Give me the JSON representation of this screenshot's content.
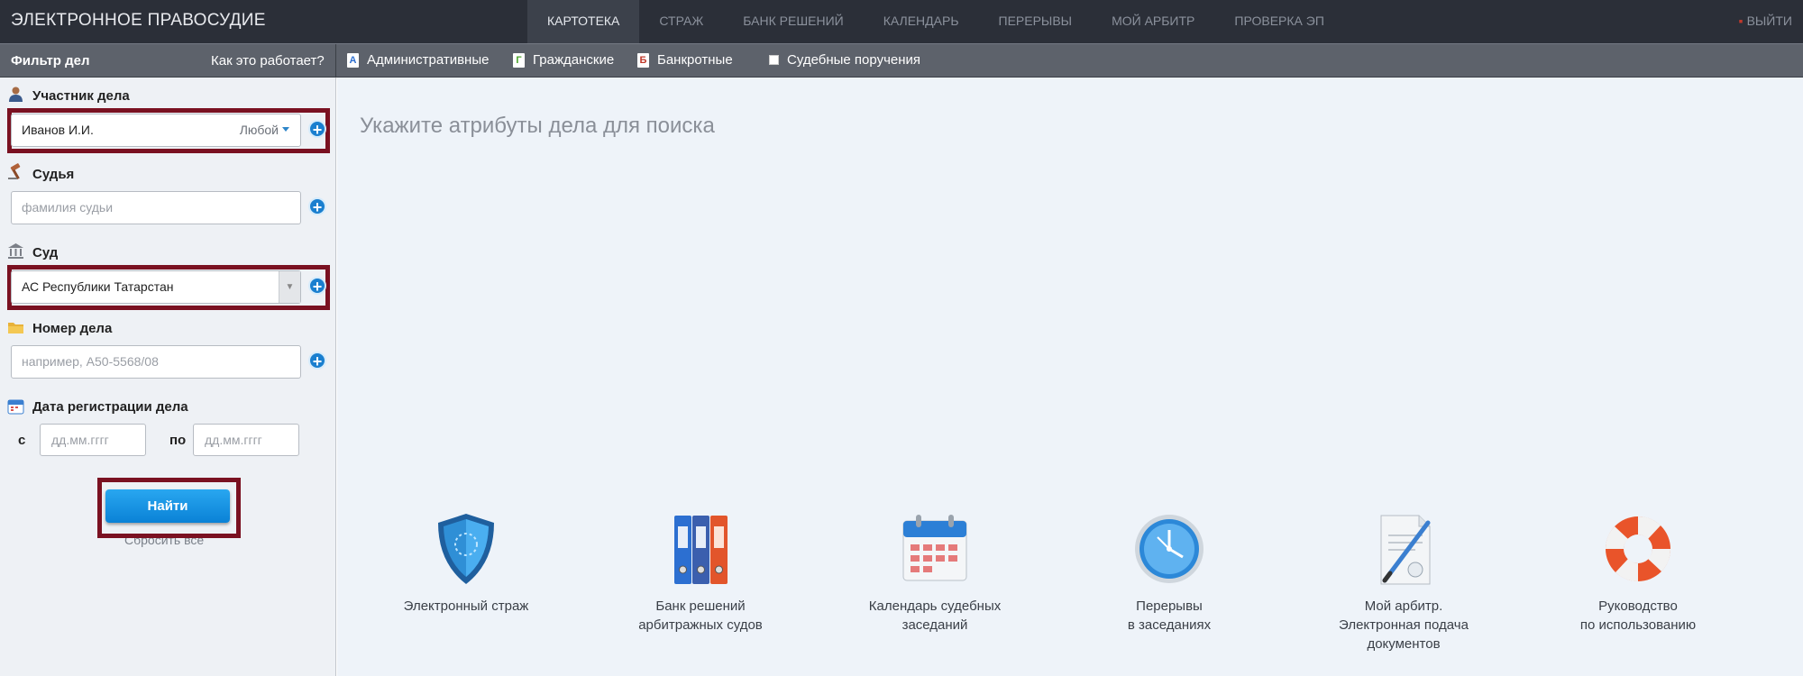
{
  "brand": "ЭЛЕКТРОННОЕ ПРАВОСУДИЕ",
  "nav": [
    {
      "label": "КАРТОТЕКА",
      "active": true
    },
    {
      "label": "СТРАЖ"
    },
    {
      "label": "БАНК РЕШЕНИЙ"
    },
    {
      "label": "КАЛЕНДАРЬ"
    },
    {
      "label": "ПЕРЕРЫВЫ"
    },
    {
      "label": "МОЙ АРБИТР"
    },
    {
      "label": "ПРОВЕРКА ЭП"
    }
  ],
  "logout": "ВЫЙТИ",
  "subbar": {
    "filter_title": "Фильтр дел",
    "howto": "Как это работает?",
    "types": [
      {
        "label": "Административные",
        "badge": "А",
        "color": "#2e6fd0"
      },
      {
        "label": "Гражданские",
        "badge": "Г",
        "color": "#4aa329"
      },
      {
        "label": "Банкротные",
        "badge": "Б",
        "color": "#c0392b"
      }
    ],
    "checkbox_label": "Судебные поручения"
  },
  "filter": {
    "participant": {
      "label": "Участник дела",
      "value": "Иванов И.И.",
      "role": "Любой"
    },
    "judge": {
      "label": "Судья",
      "placeholder": "фамилия судьи"
    },
    "court": {
      "label": "Суд",
      "value": "АС Республики Татарстан"
    },
    "case_number": {
      "label": "Номер дела",
      "placeholder": "например, А50-5568/08"
    },
    "reg_date": {
      "label": "Дата регистрации дела",
      "from_label": "с",
      "to_label": "по",
      "from_placeholder": "дд.мм.гггг",
      "to_placeholder": "дд.мм.гггг"
    },
    "find_button": "Найти",
    "reset": "Сбросить все"
  },
  "main": {
    "prompt": "Укажите атрибуты дела для поиска",
    "tiles": [
      {
        "line1": "Электронный страж",
        "line2": "",
        "line3": "",
        "icon": "shield-icon"
      },
      {
        "line1": "Банк решений",
        "line2": "арбитражных судов",
        "line3": "",
        "icon": "binders-icon"
      },
      {
        "line1": "Календарь судебных",
        "line2": "заседаний",
        "line3": "",
        "icon": "calendar-icon"
      },
      {
        "line1": "Перерывы",
        "line2": "в заседаниях",
        "line3": "",
        "icon": "clock-icon"
      },
      {
        "line1": "Мой арбитр.",
        "line2": "Электронная подача",
        "line3": "документов",
        "icon": "document-pen-icon"
      },
      {
        "line1": "Руководство",
        "line2": "по использованию",
        "line3": "",
        "icon": "lifebuoy-icon"
      }
    ]
  },
  "colors": {
    "topbar": "#2b2f38",
    "subbar": "#5d626b",
    "accent": "#1a7fcf",
    "highlight": "#7a1121"
  }
}
